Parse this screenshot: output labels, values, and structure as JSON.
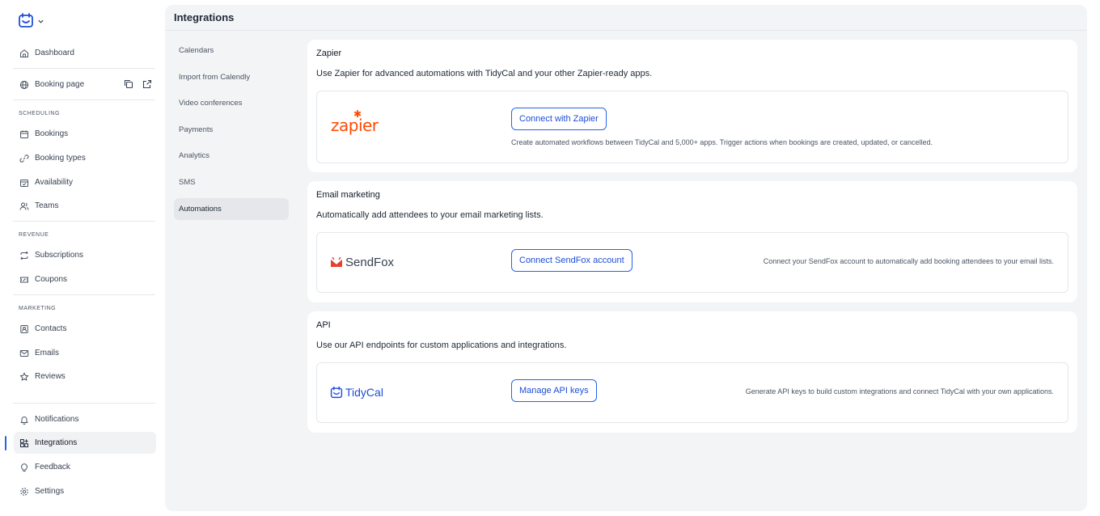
{
  "sidebar": {
    "primary": [
      {
        "label": "Dashboard",
        "icon": "home-icon"
      },
      {
        "label": "Booking page",
        "icon": "globe-icon"
      }
    ],
    "sections": [
      {
        "title": "SCHEDULING",
        "items": [
          {
            "label": "Bookings",
            "icon": "calendar-icon"
          },
          {
            "label": "Booking types",
            "icon": "link-icon"
          },
          {
            "label": "Availability",
            "icon": "calendar-check-icon"
          },
          {
            "label": "Teams",
            "icon": "users-icon"
          }
        ]
      },
      {
        "title": "REVENUE",
        "items": [
          {
            "label": "Subscriptions",
            "icon": "repeat-icon"
          },
          {
            "label": "Coupons",
            "icon": "ticket-icon"
          }
        ]
      },
      {
        "title": "MARKETING",
        "items": [
          {
            "label": "Contacts",
            "icon": "contact-icon"
          },
          {
            "label": "Emails",
            "icon": "mail-icon"
          },
          {
            "label": "Reviews",
            "icon": "star-icon"
          }
        ]
      }
    ],
    "bottom": [
      {
        "label": "Notifications",
        "icon": "bell-icon"
      },
      {
        "label": "Integrations",
        "icon": "integrations-icon",
        "active": true
      },
      {
        "label": "Feedback",
        "icon": "lightbulb-icon"
      },
      {
        "label": "Settings",
        "icon": "gear-icon"
      }
    ]
  },
  "main": {
    "title": "Integrations",
    "subnav": [
      "Calendars",
      "Import from Calendly",
      "Video conferences",
      "Payments",
      "Analytics",
      "SMS",
      "Automations"
    ],
    "active_subnav": "Automations",
    "cards": [
      {
        "title": "Zapier",
        "description": "Use Zapier for advanced automations with TidyCal and your other Zapier-ready apps.",
        "logo_text": "zapier",
        "button": "Connect with Zapier",
        "hint": "Create automated workflows between TidyCal and 5,000+ apps. Trigger actions when bookings are created, updated, or cancelled."
      },
      {
        "title": "Email marketing",
        "description": "Automatically add attendees to your email marketing lists.",
        "logo_text": "SendFox",
        "button": "Connect SendFox account",
        "hint": "Connect your SendFox account to automatically add booking attendees to your email lists."
      },
      {
        "title": "API",
        "description": "Use our API endpoints for custom applications and integrations.",
        "logo_text": "TidyCal",
        "button": "Manage API keys",
        "hint": "Generate API keys to build custom integrations and connect TidyCal with your own applications."
      }
    ]
  },
  "colors": {
    "accent": "#2563eb",
    "zapier": "#ff4a00",
    "sendfox": "#e8412d",
    "panel": "#f3f4f6"
  }
}
